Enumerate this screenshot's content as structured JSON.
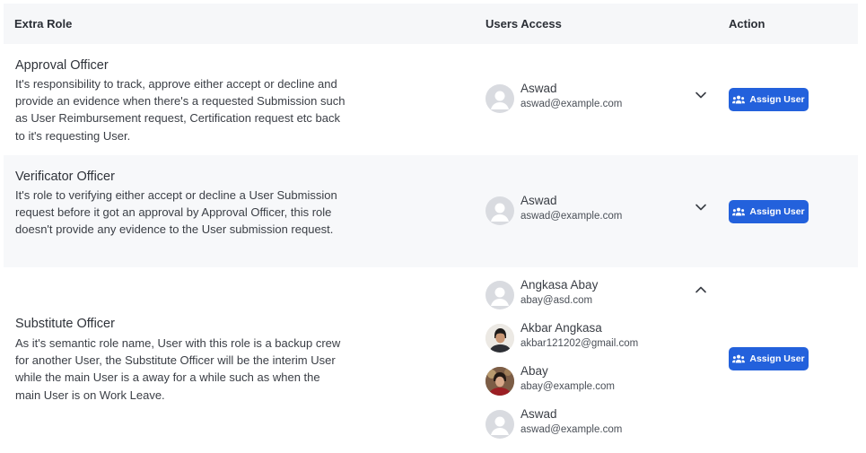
{
  "table": {
    "headers": {
      "role": "Extra Role",
      "users": "Users Access",
      "action": "Action"
    },
    "rows": [
      {
        "name": "Approval Officer",
        "description": "It's responsibility to track, approve either accept or decline and provide an evidence when there's a requested Submission such as User Reimbursement request, Certification request etc back to it's requesting User.",
        "expanded": false,
        "users": [
          {
            "name": "Aswad",
            "email": "aswad@example.com",
            "avatar": "placeholder-avatar"
          }
        ],
        "button_label": "Assign User"
      },
      {
        "name": "Verificator Officer",
        "description": "It's role to verifying either accept or decline a User Submission request before it got an approval by Approval Officer, this role doesn't provide any evidence to the User submission request.",
        "expanded": false,
        "users": [
          {
            "name": "Aswad",
            "email": "aswad@example.com",
            "avatar": "placeholder-avatar"
          }
        ],
        "button_label": "Assign User"
      },
      {
        "name": "Substitute Officer",
        "description": "As it's semantic role name, User with this role is a backup crew for another User, the Substitute Officer will be the interim User while the main User is a away for a while such as when the main User is on Work Leave.",
        "expanded": true,
        "users": [
          {
            "name": "Angkasa Abay",
            "email": "abay@asd.com",
            "avatar": "placeholder-avatar"
          },
          {
            "name": "Akbar Angkasa",
            "email": "akbar121202@gmail.com",
            "avatar": "photo-avatar"
          },
          {
            "name": "Abay",
            "email": "abay@example.com",
            "avatar": "photo-avatar"
          },
          {
            "name": "Aswad",
            "email": "aswad@example.com",
            "avatar": "placeholder-avatar"
          }
        ],
        "button_label": "Assign User"
      }
    ]
  },
  "icons": {
    "expand": "chevron-down-icon",
    "collapse": "chevron-up-icon",
    "assign": "users-icon"
  },
  "colors": {
    "accent": "#2361dc",
    "header_bg": "#f6f7f9",
    "alt_row_bg": "#f7f8fa",
    "placeholder_avatar": "#d9dbe0"
  }
}
